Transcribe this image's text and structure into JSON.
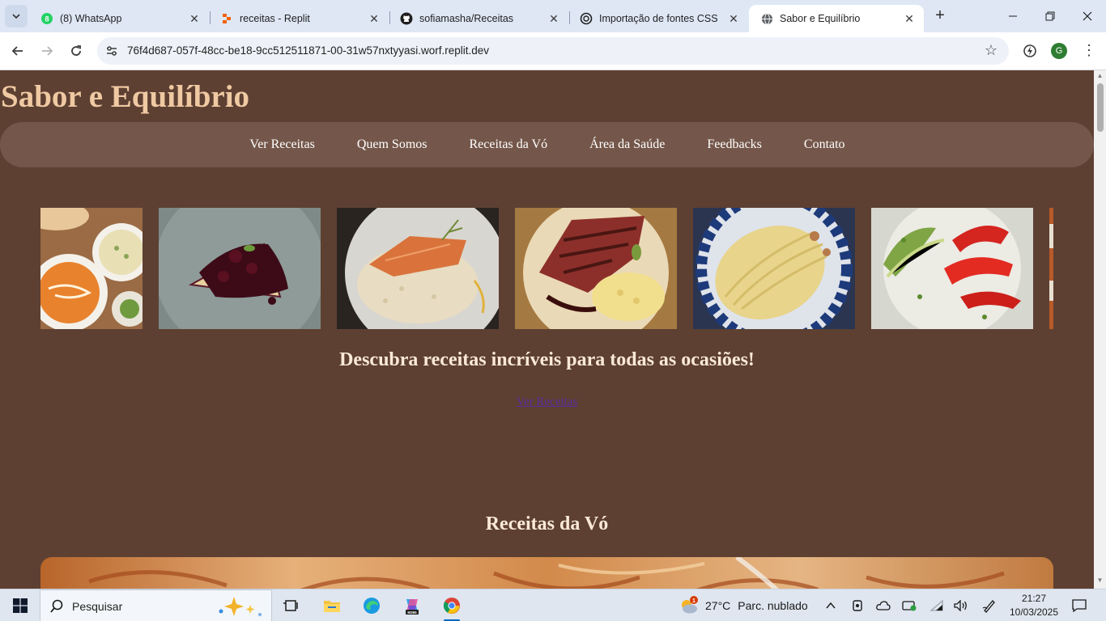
{
  "browser": {
    "tabs": [
      {
        "title": "(8) WhatsApp",
        "favicon": "whatsapp-icon",
        "active": false
      },
      {
        "title": "receitas - Replit",
        "favicon": "replit-icon",
        "active": false
      },
      {
        "title": "sofiamasha/Receitas",
        "favicon": "github-icon",
        "active": false
      },
      {
        "title": "Importação de fontes CSS",
        "favicon": "openai-icon",
        "active": false
      },
      {
        "title": "Sabor e Equilíbrio",
        "favicon": "globe-icon",
        "active": true
      }
    ],
    "new_tab_glyph": "+",
    "url": "76f4d687-057f-48cc-be18-9cc512511871-00-31w57nxtyyasi.worf.replit.dev",
    "profile_initial": "G"
  },
  "page": {
    "site_title": "Sabor e Equilíbrio",
    "nav": [
      "Ver Receitas",
      "Quem Somos",
      "Receitas da Vó",
      "Área da Saúde",
      "Feedbacks",
      "Contato"
    ],
    "carousel_images": [
      "indian-curry-dishes",
      "berry-cheesecake",
      "salmon-risotto",
      "grilled-steak-risotto",
      "carbonara-pasta",
      "lobster-avocado"
    ],
    "tagline": "Descubra receitas incríveis para todas as ocasiões!",
    "cta_link": "Ver Receitas",
    "section_title": "Receitas da Vó",
    "colors": {
      "background": "#5d4032",
      "nav_bar": "#74574a",
      "title": "#efc9a2",
      "heading": "#fbe9d6",
      "link": "#5a2ca0"
    }
  },
  "taskbar": {
    "search_placeholder": "Pesquisar",
    "weather_temp": "27°C",
    "weather_desc": "Parc. nublado",
    "weather_badge": "1",
    "time": "21:27",
    "date": "10/03/2025"
  }
}
